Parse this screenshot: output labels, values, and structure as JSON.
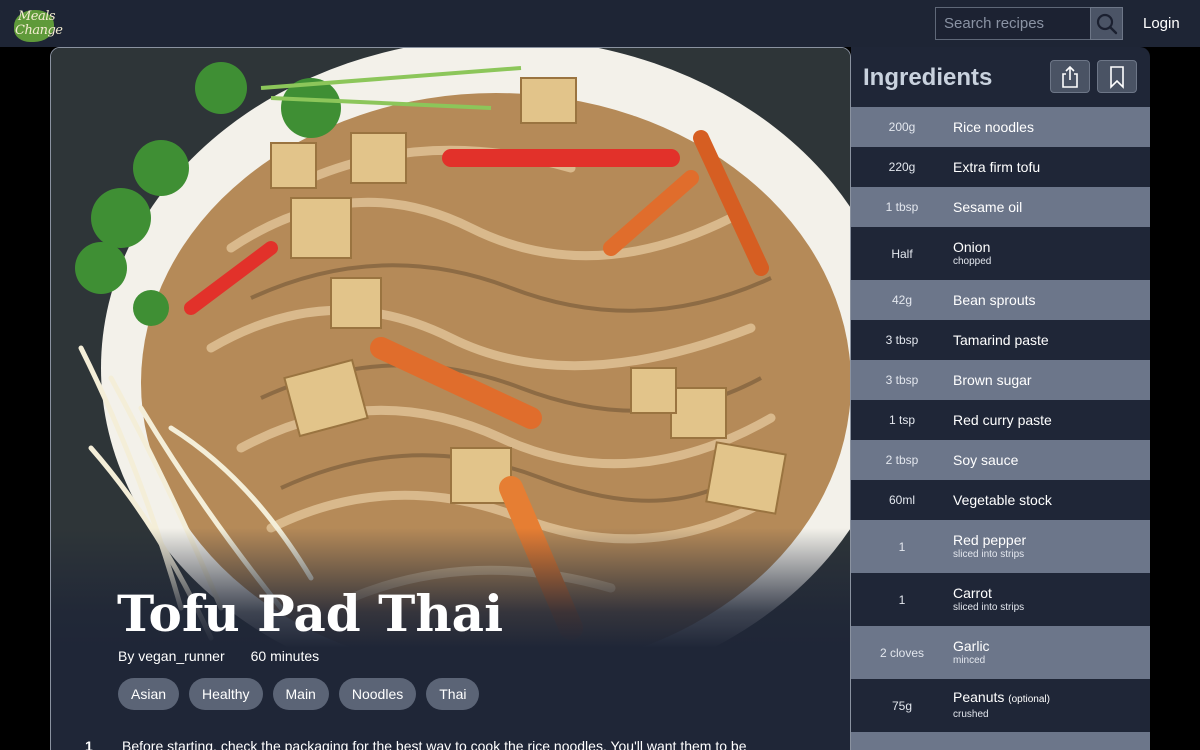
{
  "header": {
    "logo_line1": "Meals",
    "logo_line2": "Change",
    "search_placeholder": "Search recipes",
    "login_label": "Login"
  },
  "recipe": {
    "title": "Tofu Pad Thai",
    "author": "By vegan_runner",
    "duration": "60 minutes",
    "tags": [
      "Asian",
      "Healthy",
      "Main",
      "Noodles",
      "Thai"
    ],
    "steps": [
      {
        "number": "1",
        "text": "Before starting, check the packaging for the best way to cook the rice noodles. You'll want them to be"
      }
    ]
  },
  "ingredients": {
    "heading": "Ingredients",
    "items": [
      {
        "qty": "200g",
        "name": "Rice noodles"
      },
      {
        "qty": "220g",
        "name": "Extra firm tofu"
      },
      {
        "qty": "1 tbsp",
        "name": "Sesame oil"
      },
      {
        "qty": "Half",
        "name": "Onion",
        "note": "chopped"
      },
      {
        "qty": "42g",
        "name": "Bean sprouts"
      },
      {
        "qty": "3 tbsp",
        "name": "Tamarind paste"
      },
      {
        "qty": "3 tbsp",
        "name": "Brown sugar"
      },
      {
        "qty": "1 tsp",
        "name": "Red curry paste"
      },
      {
        "qty": "2 tbsp",
        "name": "Soy sauce"
      },
      {
        "qty": "60ml",
        "name": "Vegetable stock"
      },
      {
        "qty": "1",
        "name": "Red pepper",
        "note": "sliced into strips"
      },
      {
        "qty": "1",
        "name": "Carrot",
        "note": "sliced into strips"
      },
      {
        "qty": "2 cloves",
        "name": "Garlic",
        "note": "minced"
      },
      {
        "qty": "75g",
        "name": "Peanuts",
        "optional": "(optional)",
        "note": "crushed"
      }
    ]
  },
  "colors": {
    "topbar": "#1e2535",
    "panel": "#1f2637",
    "row_alt": "#6c768a",
    "tag": "#5b6476"
  }
}
